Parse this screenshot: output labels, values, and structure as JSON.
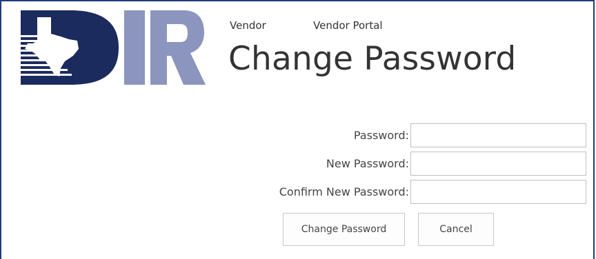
{
  "logo": {
    "text": "DIR",
    "name": "Texas DIR logo"
  },
  "breadcrumb": {
    "items": [
      "Vendor",
      "Vendor Portal"
    ]
  },
  "page": {
    "title": "Change Password"
  },
  "form": {
    "password_label": "Password:",
    "password_value": "",
    "new_password_label": "New Password:",
    "new_password_value": "",
    "confirm_password_label": "Confirm New Password:",
    "confirm_password_value": ""
  },
  "buttons": {
    "change_password": "Change Password",
    "cancel": "Cancel"
  },
  "colors": {
    "logo_navy": "#1c2b5e",
    "logo_slate": "#8c95bd",
    "frame_border": "#1f3d7a",
    "text": "#333333"
  }
}
